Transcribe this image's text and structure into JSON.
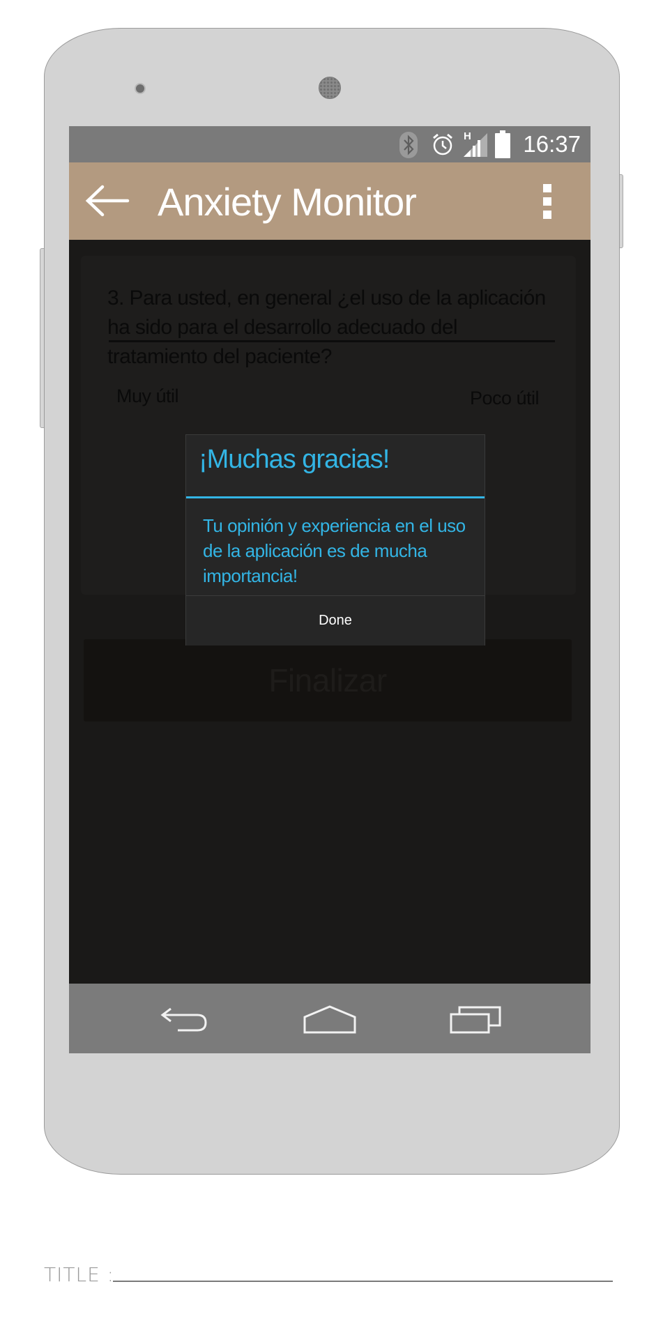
{
  "status_bar": {
    "time": "16:37",
    "network_type": "H",
    "icons": [
      "bluetooth-icon",
      "alarm-icon",
      "signal-icon",
      "battery-icon"
    ]
  },
  "app_bar": {
    "title": "Anxiety Monitor",
    "color": "#b39a80"
  },
  "survey": {
    "question": "3. Para usted, en general ¿el uso de la aplicación ha sido para el desarrollo adecuado del tratamiento del paciente?",
    "scale_min_label": "Muy útil",
    "scale_max_label": "Poco útil",
    "finish_label": "Finalizar"
  },
  "dialog": {
    "title": "¡Muchas gracias!",
    "message": "Tu opinión y experiencia en el uso de la aplicación es de mucha importancia!",
    "done_label": "Done",
    "accent_color": "#33b5e5"
  },
  "footer": {
    "title_label": "TITLE :"
  }
}
